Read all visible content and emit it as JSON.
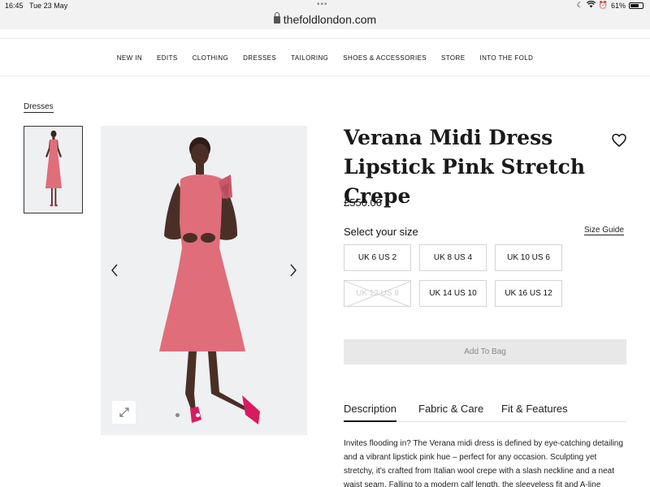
{
  "status_bar": {
    "time": "16:45",
    "date": "Tue 23 May",
    "dots": "•••",
    "battery": "61%",
    "battery_level": 0.61
  },
  "browser": {
    "url": "thefoldlondon.com"
  },
  "nav": {
    "items": [
      {
        "label": "NEW IN"
      },
      {
        "label": "EDITS"
      },
      {
        "label": "CLOTHING"
      },
      {
        "label": "DRESSES"
      },
      {
        "label": "TAILORING"
      },
      {
        "label": "SHOES & ACCESSORIES"
      },
      {
        "label": "STORE"
      },
      {
        "label": "INTO THE FOLD"
      }
    ]
  },
  "breadcrumb": "Dresses",
  "product": {
    "title": "Verana Midi Dress Lipstick Pink Stretch Crepe",
    "price": "£550.00",
    "select_size_label": "Select your size",
    "size_guide_label": "Size Guide",
    "sizes": [
      {
        "label": "UK 6 US 2",
        "available": true
      },
      {
        "label": "UK 8 US 4",
        "available": true
      },
      {
        "label": "UK 10 US 6",
        "available": true
      },
      {
        "label": "UK 12 US 8",
        "available": false
      },
      {
        "label": "UK 14 US 10",
        "available": true
      },
      {
        "label": "UK 16 US 12",
        "available": true
      }
    ],
    "add_to_bag_label": "Add To Bag",
    "dress_color": "#e06d7a"
  },
  "tabs": [
    {
      "label": "Description",
      "active": true
    },
    {
      "label": "Fabric & Care",
      "active": false
    },
    {
      "label": "Fit & Features",
      "active": false
    }
  ],
  "description": "Invites flooding in? The Verana midi dress is defined by eye-catching detailing and a vibrant lipstick pink hue – perfect for any occasion. Sculpting yet stretchy, it's crafted from Italian wool crepe with a slash neckline and a neat waist seam. Falling to a modern calf length, the sleeveless fit and A-line",
  "gallery": {
    "active_index": 1,
    "count": 2
  }
}
